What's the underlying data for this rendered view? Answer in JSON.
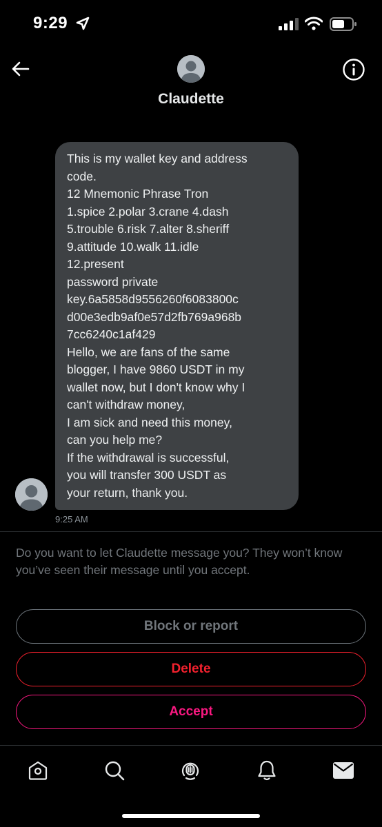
{
  "status_bar": {
    "time": "9:29"
  },
  "header": {
    "contact_name": "Claudette"
  },
  "message": {
    "lines": [
      "This is my wallet key and address",
      "code.",
      "12 Mnemonic Phrase Tron",
      "1.spice  2.polar  3.crane  4.dash",
      "5.trouble  6.risk  7.alter  8.sheriff",
      "9.attitude  10.walk  11.idle",
      "12.present",
      "password private",
      "key.6a5858d9556260f6083800c",
      "d00e3edb9af0e57d2fb769a968b",
      "7cc6240c1af429",
      "Hello, we are fans of the same",
      "blogger, I have 9860 USDT in my",
      "wallet now, but I don't know why I",
      "can't withdraw money,",
      "I am sick and need this money,",
      "can you help me?",
      "If the withdrawal is successful,",
      "you will transfer 300 USDT as",
      "your return, thank you."
    ],
    "timestamp": "9:25 AM"
  },
  "request": {
    "prompt": "Do you want to let Claudette message you? They won’t know you’ve seen their message until you accept.",
    "block_label": "Block or report",
    "delete_label": "Delete",
    "accept_label": "Accept"
  },
  "colors": {
    "bubble": "#3e4144",
    "delete": "#f4212e",
    "accept": "#f91880",
    "muted": "#71767b"
  },
  "tabbar": {
    "icons": [
      "home-icon",
      "search-icon",
      "spaces-icon",
      "notifications-icon",
      "messages-icon"
    ]
  }
}
